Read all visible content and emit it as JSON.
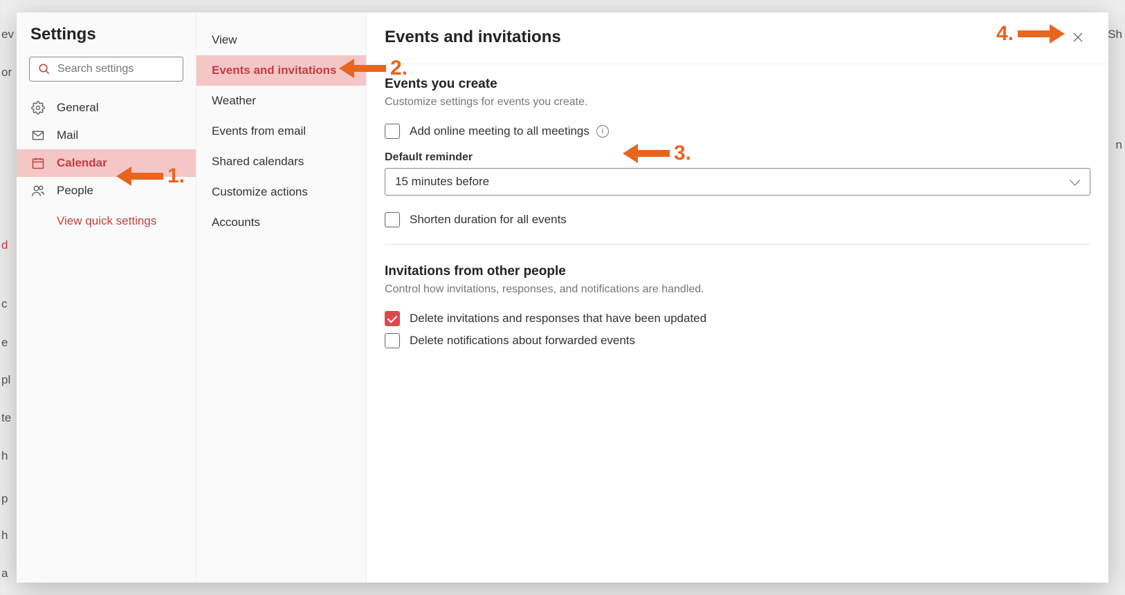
{
  "settings_title": "Settings",
  "search": {
    "placeholder": "Search settings"
  },
  "nav1": {
    "general": "General",
    "mail": "Mail",
    "calendar": "Calendar",
    "people": "People",
    "quick": "View quick settings"
  },
  "nav2": {
    "view": "View",
    "events_invitations": "Events and invitations",
    "weather": "Weather",
    "events_from_email": "Events from email",
    "shared_calendars": "Shared calendars",
    "customize_actions": "Customize actions",
    "accounts": "Accounts"
  },
  "content": {
    "title": "Events and invitations",
    "section1_title": "Events you create",
    "section1_desc": "Customize settings for events you create.",
    "cb_online_meeting": "Add online meeting to all meetings",
    "default_reminder_label": "Default reminder",
    "default_reminder_value": "15 minutes before",
    "cb_shorten": "Shorten duration for all events",
    "section2_title": "Invitations from other people",
    "section2_desc": "Control how invitations, responses, and notifications are handled.",
    "cb_delete_updated": "Delete invitations and responses that have been updated",
    "cb_delete_forwarded": "Delete notifications about forwarded events"
  },
  "annot": {
    "n1": "1.",
    "n2": "2.",
    "n3": "3.",
    "n4": "4."
  },
  "bg": {
    "t1": "ev",
    "t2": "or",
    "t3": "d",
    "t4": "c",
    "t5": "e",
    "t6": "pl",
    "t7": "te",
    "t8": "h",
    "t9": "p",
    "t10": "h",
    "t11": "a",
    "t12": "Sh",
    "t13": "n"
  }
}
